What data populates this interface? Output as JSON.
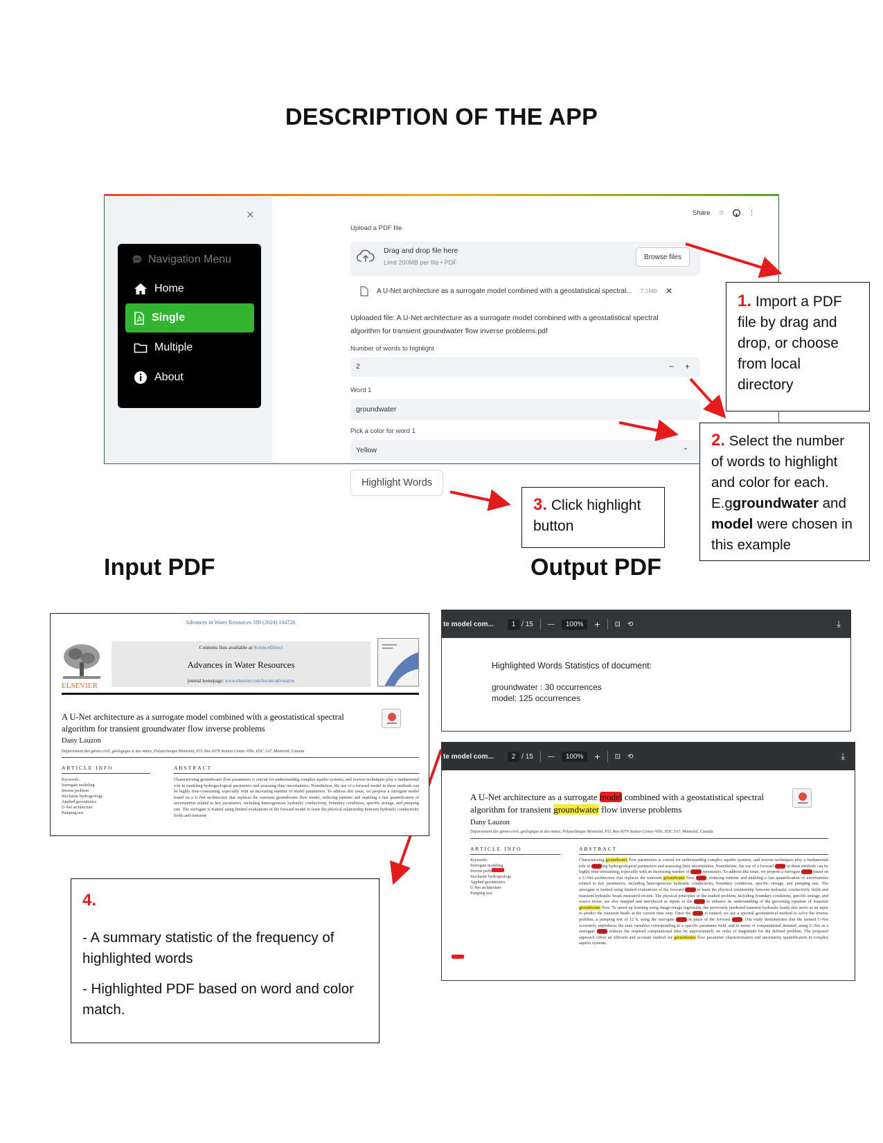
{
  "page": {
    "title": "DESCRIPTION OF THE APP"
  },
  "app": {
    "sidebar": {
      "close": "×",
      "nav_title": "Navigation Menu",
      "items": [
        {
          "label": "Home",
          "icon": "house-icon",
          "active": false
        },
        {
          "label": "Single",
          "icon": "pdf-file-icon",
          "active": true
        },
        {
          "label": "Multiple",
          "icon": "folder-icon",
          "active": false
        },
        {
          "label": "About",
          "icon": "info-icon",
          "active": false
        }
      ],
      "active_color": "#32b632"
    },
    "toolbar": {
      "share": "Share"
    },
    "upload": {
      "label": "Upload a PDF file",
      "drop_text": "Drag and drop file here",
      "limit_text": "Limit 200MB per file • PDF",
      "browse_label": "Browse files",
      "file_name": "A U-Net architecture as a surrogate model combined with a geostatistical spectral...",
      "file_size": "7.1MB",
      "uploaded_text": "Uploaded file: A U-Net architecture as a surrogate model combined with a geostatistical spectral algorithm for transient groundwater flow inverse problems.pdf"
    },
    "num_words": {
      "label": "Number of words to highlight",
      "value": "2"
    },
    "word1": {
      "label": "Word 1",
      "value": "groundwater"
    },
    "color1": {
      "label": "Pick a color for word 1",
      "value": "Yellow"
    },
    "highlight_button": "Highlight Words"
  },
  "callouts": {
    "c1": {
      "num": "1.",
      "text": "Import a PDF file by drag and drop, or choose from local directory"
    },
    "c2": {
      "num": "2.",
      "text_a": "Select the number of words to  highlight and color for each. E.g",
      "bold1": "groundwater",
      "and": "and",
      "bold2": "model",
      "text_b": "were chosen in this example"
    },
    "c3": {
      "num": "3.",
      "text": "Click highlight button"
    },
    "c4": {
      "num": "4.",
      "line1": "- A summary statistic of the frequency of highlighted words",
      "line2": " - Highlighted PDF based on word and color match."
    }
  },
  "sections": {
    "input": "Input PDF",
    "output": "Output PDF"
  },
  "input_pdf": {
    "journal_ref": "Advances in Water Resources 189 (2024) 104726",
    "contents_prefix": "Contents lists available at",
    "sciencedirect": "ScienceDirect",
    "journal": "Advances in Water Resources",
    "homepage_prefix": "journal homepage:",
    "homepage_link": "www.elsevier.com/locate/advwatres",
    "publisher": "ELSEVIER",
    "title": "A U-Net architecture as a surrogate model combined with a geostatistical spectral algorithm for transient groundwater flow inverse problems",
    "author": "Dany Lauzon",
    "affiliation": "Département des génies civil, géologique et des mines, Polytechnique Montréal, P.O. Box 6079 Station Centre-Ville, H3C 3A7, Montréal, Canada",
    "article_info": "ARTICLE INFO",
    "abstract_head": "ABSTRACT",
    "keywords_label": "Keywords:",
    "keywords": [
      "Surrogate modeling",
      "Inverse problem",
      "Stochastic hydrogeology",
      "Applied geostatistics",
      "U-Net architecture",
      "Pumping test"
    ],
    "abstract": "Characterizing groundwater flow parameters is crucial for understanding complex aquifer systems, and inverse techniques play a fundamental role in modeling hydrogeological parameters and assessing their uncertainties. Nonetheless, the use of a forward model in these methods can be highly time-consuming, especially with an increasing number of model parameters. To address this issue, we propose a surrogate model based on a U-Net architecture that replaces the transient groundwater flow model, reducing runtime and enabling a fast quantification of uncertainties related to key parameters, including heterogeneous hydraulic conductivity, boundary conditions, specific storage, and pumping rate. The surrogate is trained using limited evaluations of the forward model to learn the physical relationship between hydraulic conductivity fields and transient"
  },
  "output_pdf": {
    "viewer": {
      "doc_name": "te model com...",
      "page1": "1",
      "page2": "2",
      "total": "/ 15",
      "zoom": "100%"
    },
    "stats_title": "Highlighted Words Statistics of document:",
    "stats": [
      "groundwater : 30 occurrences",
      "model: 125 occurrences"
    ],
    "title_a": "A U-Net architecture as a surrogate ",
    "title_model": "model",
    "title_b": " combined with a geostatistical spectral algorithm for transient ",
    "title_gw": "groundwater",
    "title_c": " flow inverse problems",
    "author": "Dany Lauzon",
    "affiliation": "Département des génies civil, géologique et des mines, Polytechnique Montréal, P.O. Box 6079 Station Centre-Ville, H3C 3A7, Montréal, Canada",
    "article_info": "ARTICLE INFO",
    "abstract_head": "ABSTRACT",
    "keywords_label": "Keywords:",
    "keywords": [
      "Surrogate modeling",
      "Inverse problem",
      "Stochastic hydrogeology",
      "Applied geostatistics",
      "U-Net architecture",
      "Pumping test"
    ],
    "abstract": "Characterizing groundwater flow parameters is crucial for understanding complex aquifer systems, and inverse techniques play a fundamental role in modeling hydrogeological parameters and assessing their uncertainties. Nonetheless, the use of a forward model in these methods can be highly time-consuming, especially with an increasing number of model parameters. To address this issue, we propose a surrogate model based on a U-Net architecture that replaces the transient groundwater flow model, reducing runtime and enabling a fast quantification of uncertainties related to key parameters, including heterogeneous hydraulic conductivity, boundary conditions, specific storage, and pumping rate. The surrogate is trained using limited evaluations of the forward model to learn the physical relationship between hydraulic conductivity fields and transient hydraulic heads measured on-site. The physical principles of the studied problem, including boundary conditions, specific storage, and source terms, are also mapped and introduced as inputs to the model to enhance its understanding of the governing equation of transient groundwater flow. To speed up learning using image-image regression, the previously predicted transient hydraulic heads also serve as an input to predict the transient heads at the current time step. Once the model is trained, we use a spectral geostatistical method to solve the inverse problem, a pumping test of 12 h, using the surrogate model in place of the forward model. Our study demonstrates that the trained U-Net accurately reproduces the state variables corresponding to a specific parameter field, and in terms of computational demand, using U-Net as a surrogate model reduces the required computational time by approximately an order of magnitude for the defined problem. The proposed approach offers an efficient and accurate method for groundwater flow parameter characterization and uncertainty quantification in complex aquifer systems."
  },
  "colors": {
    "arrow": "#e31d1d",
    "highlight_yellow": "#f5ea3c",
    "highlight_red": "#e81c1c"
  }
}
